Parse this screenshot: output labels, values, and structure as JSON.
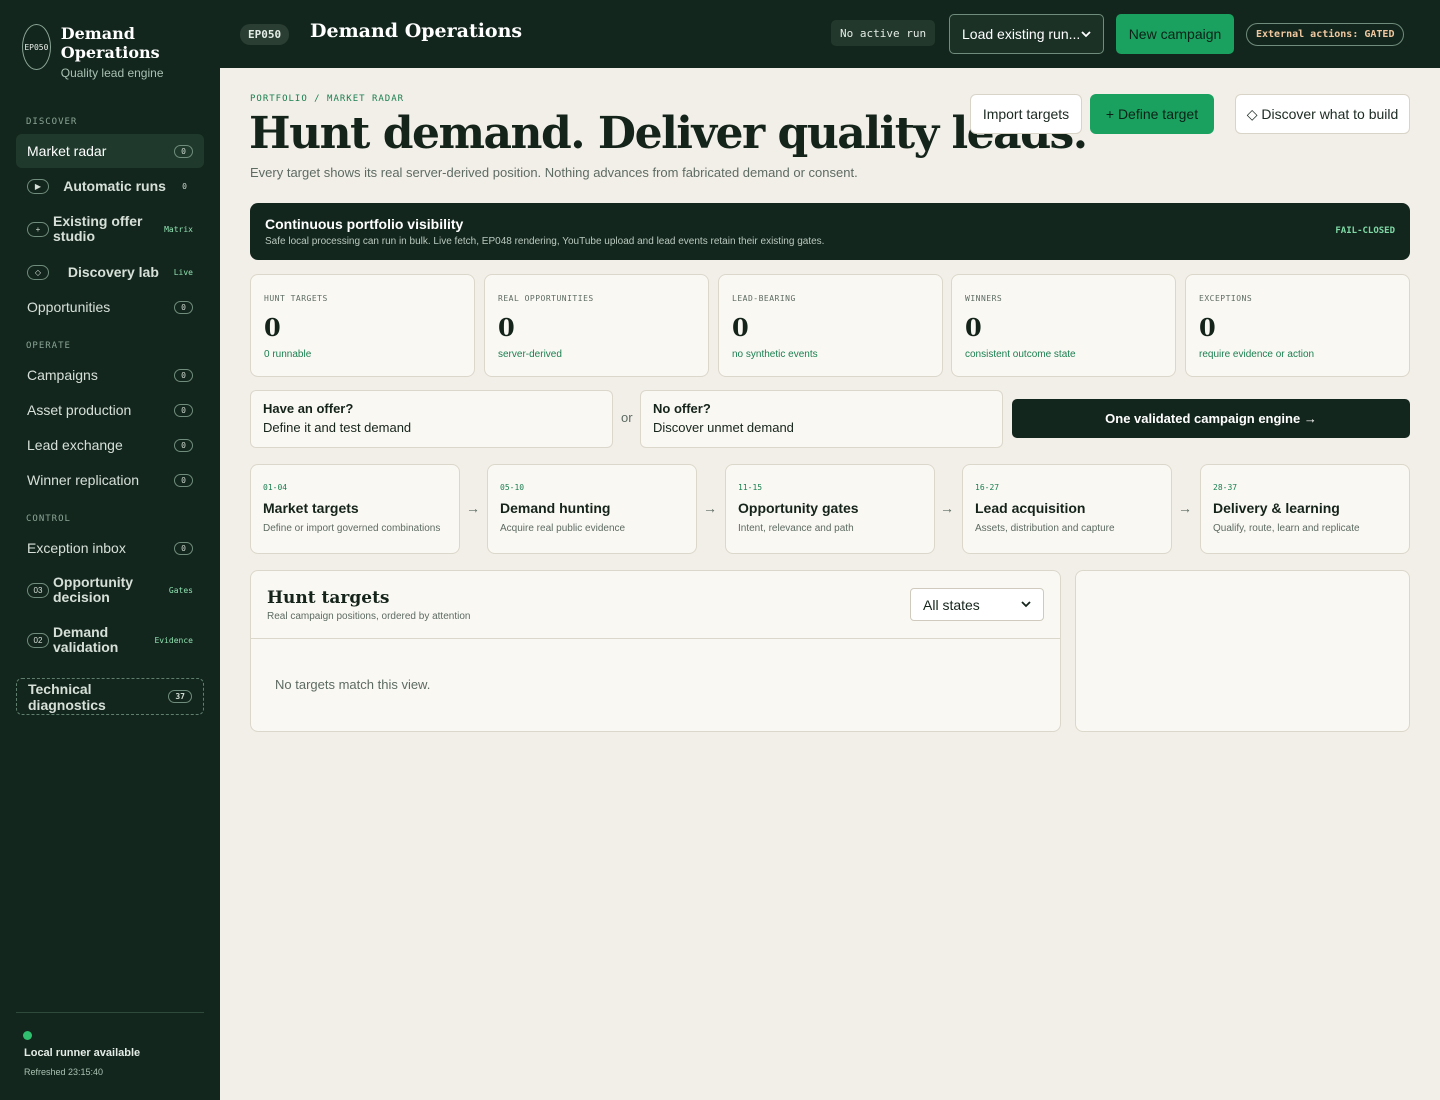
{
  "brand": {
    "badge": "EP050",
    "title": "Demand Operations",
    "subtitle": "Quality lead engine"
  },
  "sidebar": {
    "sections": {
      "discover": "DISCOVER",
      "operate": "OPERATE",
      "control": "CONTROL"
    },
    "discover_items": [
      {
        "label": "Market radar",
        "count": "0"
      },
      {
        "label": "Automatic runs",
        "icon": "▶",
        "count": "0"
      },
      {
        "label": "Existing offer studio",
        "icon": "+",
        "tag": "Matrix"
      },
      {
        "label": "Discovery lab",
        "icon": "◇",
        "tag": "Live"
      },
      {
        "label": "Opportunities",
        "count": "0"
      }
    ],
    "operate_items": [
      {
        "label": "Campaigns",
        "count": "0"
      },
      {
        "label": "Asset production",
        "count": "0"
      },
      {
        "label": "Lead exchange",
        "count": "0"
      },
      {
        "label": "Winner replication",
        "count": "0"
      }
    ],
    "control_items": [
      {
        "label": "Exception inbox",
        "count": "0"
      },
      {
        "label": "Opportunity decision",
        "icon": "03",
        "tag": "Gates"
      },
      {
        "label": "Demand validation",
        "icon": "02",
        "tag": "Evidence"
      }
    ],
    "diagnostics": {
      "label": "Technical diagnostics",
      "count": "37"
    },
    "runner": {
      "status": "Local runner available",
      "refreshed": "Refreshed 23:15:40"
    }
  },
  "topbar": {
    "badge": "EP050",
    "title": "Demand Operations",
    "run_status": "No active run",
    "load_select": "Load existing run...",
    "new_campaign": "New campaign",
    "external": "External actions: GATED"
  },
  "header": {
    "breadcrumb": "PORTFOLIO / MARKET RADAR",
    "headline": "Hunt demand. Deliver quality leads.",
    "subline": "Every target shows its real server-derived position. Nothing advances from fabricated demand or consent.",
    "import_label": "Import targets",
    "define_label": "+  Define target",
    "discover_label": "◇ Discover what to build"
  },
  "banner": {
    "title": "Continuous portfolio visibility",
    "subtitle": "Safe local processing can run in bulk. Live fetch, EP048 rendering, YouTube upload and lead events retain their existing gates.",
    "tag": "FAIL-CLOSED"
  },
  "stats": [
    {
      "label": "HUNT TARGETS",
      "value": "0",
      "note": "0 runnable"
    },
    {
      "label": "REAL OPPORTUNITIES",
      "value": "0",
      "note": "server-derived"
    },
    {
      "label": "LEAD-BEARING",
      "value": "0",
      "note": "no synthetic events"
    },
    {
      "label": "WINNERS",
      "value": "0",
      "note": "consistent outcome state"
    },
    {
      "label": "EXCEPTIONS",
      "value": "0",
      "note": "require evidence or action"
    }
  ],
  "offers": {
    "have": {
      "q": "Have an offer?",
      "a": "Define it and test demand"
    },
    "or": "or",
    "none": {
      "q": "No offer?",
      "a": "Discover unmet demand"
    },
    "engine": "One validated campaign engine →"
  },
  "stages": [
    {
      "code": "01-04",
      "title": "Market targets",
      "desc": "Define or import governed combinations"
    },
    {
      "code": "05-10",
      "title": "Demand hunting",
      "desc": "Acquire real public evidence"
    },
    {
      "code": "11-15",
      "title": "Opportunity gates",
      "desc": "Intent, relevance and path"
    },
    {
      "code": "16-27",
      "title": "Lead acquisition",
      "desc": "Assets, distribution and capture"
    },
    {
      "code": "28-37",
      "title": "Delivery & learning",
      "desc": "Qualify, route, learn and replicate"
    }
  ],
  "stage_arrow": "→",
  "targets": {
    "title": "Hunt targets",
    "subtitle": "Real campaign positions, ordered by attention",
    "filter": "All states",
    "empty": "No targets match this view."
  }
}
